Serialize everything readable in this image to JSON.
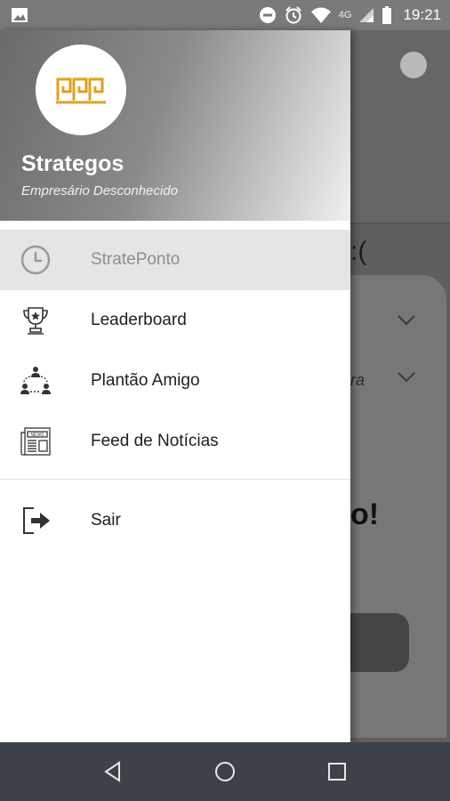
{
  "status_bar": {
    "network": "4G",
    "time": "19:21",
    "icons": [
      "image-icon",
      "do-not-disturb-icon",
      "alarm-icon",
      "wifi-icon",
      "signal-icon",
      "battery-icon"
    ]
  },
  "background_screen": {
    "sad_text": ":(",
    "partial_text": "ra",
    "big_text": "o!"
  },
  "drawer": {
    "app_name": "Strategos",
    "subtitle": "Empresário Desconhecido",
    "items": [
      {
        "label": "StratePonto",
        "icon": "clock-icon",
        "active": true
      },
      {
        "label": "Leaderboard",
        "icon": "trophy-icon",
        "active": false
      },
      {
        "label": "Plantão Amigo",
        "icon": "people-network-icon",
        "active": false
      },
      {
        "label": "Feed de Notícias",
        "icon": "newspaper-icon",
        "active": false
      }
    ],
    "secondary_items": [
      {
        "label": "Sair",
        "icon": "exit-icon"
      }
    ]
  },
  "colors": {
    "accent": "#E0A020",
    "drawer_bg": "#FFFFFF",
    "active_item_bg": "#E5E5E5",
    "nav_bar": "#3D4248"
  }
}
